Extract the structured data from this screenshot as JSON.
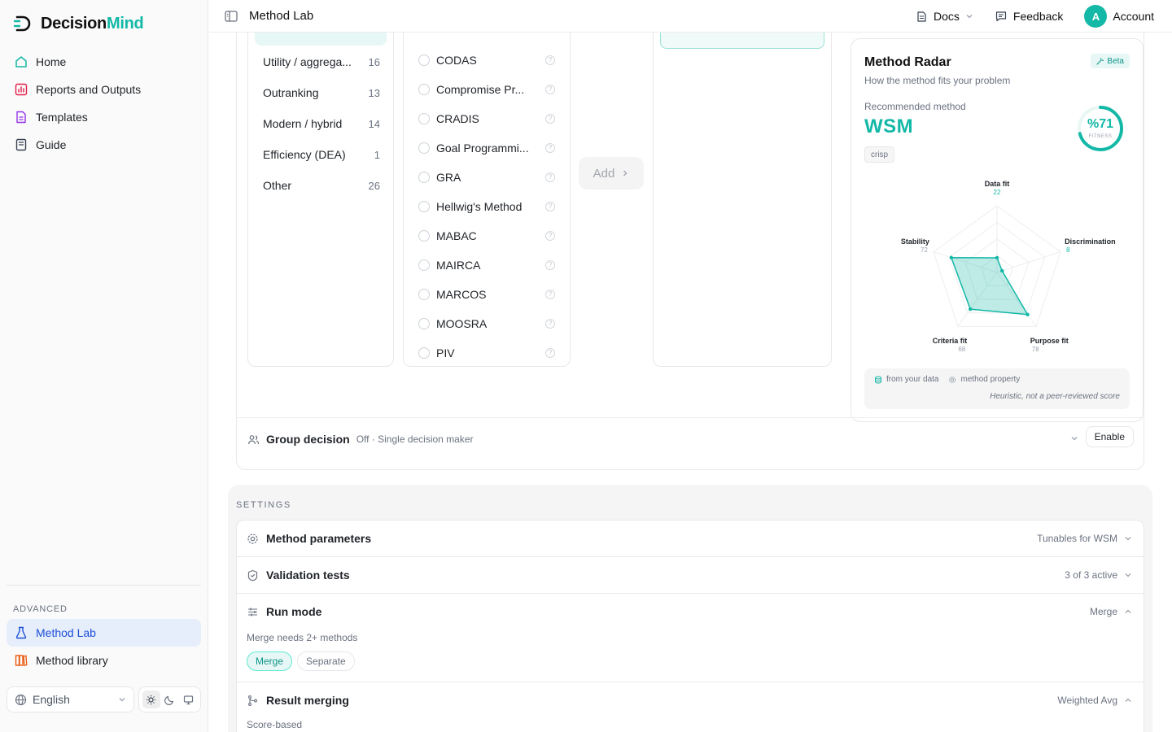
{
  "brand": {
    "name_part1": "Decision",
    "name_part2": "Mind"
  },
  "sidebar": {
    "items": [
      {
        "label": "Home",
        "icon": "home-icon"
      },
      {
        "label": "Reports and Outputs",
        "icon": "chart-icon"
      },
      {
        "label": "Templates",
        "icon": "template-icon"
      },
      {
        "label": "Guide",
        "icon": "book-icon"
      }
    ],
    "advanced_label": "ADVANCED",
    "advanced_items": [
      {
        "label": "Method Lab",
        "icon": "flask-icon",
        "active": true
      },
      {
        "label": "Method library",
        "icon": "library-icon"
      }
    ],
    "language": "English"
  },
  "topbar": {
    "title": "Method Lab",
    "docs": "Docs",
    "feedback": "Feedback",
    "avatar_letter": "A",
    "account": "Account"
  },
  "categories": [
    {
      "label": "Utility / aggrega...",
      "count": "16"
    },
    {
      "label": "Outranking",
      "count": "13"
    },
    {
      "label": "Modern / hybrid",
      "count": "14"
    },
    {
      "label": "Efficiency (DEA)",
      "count": "1"
    },
    {
      "label": "Other",
      "count": "26"
    }
  ],
  "methods": [
    {
      "label": "CODAS"
    },
    {
      "label": "Compromise Pr..."
    },
    {
      "label": "CRADIS"
    },
    {
      "label": "Goal Programmi..."
    },
    {
      "label": "GRA"
    },
    {
      "label": "Hellwig's Method"
    },
    {
      "label": "MABAC"
    },
    {
      "label": "MAIRCA"
    },
    {
      "label": "MARCOS"
    },
    {
      "label": "MOOSRA"
    },
    {
      "label": "PIV"
    }
  ],
  "add_button": "Add",
  "radar": {
    "title": "Method Radar",
    "beta": "Beta",
    "subtitle": "How the method fits your problem",
    "recommended_label": "Recommended method",
    "recommended_method": "WSM",
    "tag": "crisp",
    "fitness_value": "%71",
    "fitness_fraction": 0.71,
    "fitness_label": "FITNESS",
    "legend_data": "from your data",
    "legend_property": "method property",
    "note": "Heuristic, not a peer-reviewed score",
    "accent": "#14b8a6"
  },
  "chart_data": {
    "type": "radar",
    "axes": [
      "Data fit",
      "Discrimination",
      "Purpose fit",
      "Criteria fit",
      "Stability"
    ],
    "values": [
      22,
      8,
      78,
      68,
      72
    ],
    "range": [
      0,
      100
    ]
  },
  "group": {
    "title": "Group decision",
    "status": "Off · Single decision maker",
    "enable": "Enable"
  },
  "settings": {
    "label": "SETTINGS",
    "method_params": {
      "title": "Method parameters",
      "right": "Tunables for WSM"
    },
    "validation": {
      "title": "Validation tests",
      "right": "3 of 3 active"
    },
    "run_mode": {
      "title": "Run mode",
      "right": "Merge",
      "note": "Merge needs 2+ methods",
      "options": [
        "Merge",
        "Separate"
      ],
      "selected": "Merge"
    },
    "result_merging": {
      "title": "Result merging",
      "right": "Weighted Avg",
      "note": "Score-based"
    }
  }
}
